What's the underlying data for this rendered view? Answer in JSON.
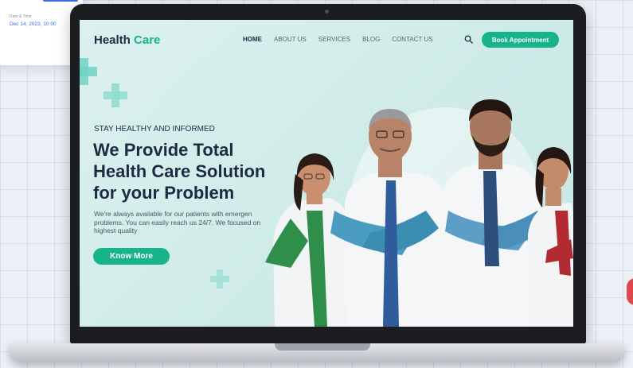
{
  "float_card": {
    "label": "Date & Time",
    "value": "Dec 14, 2023, 10:00"
  },
  "site": {
    "logo_main": "Health",
    "logo_accent": "Care",
    "nav": [
      {
        "label": "HOME",
        "active": true
      },
      {
        "label": "ABOUT US"
      },
      {
        "label": "SERVICES"
      },
      {
        "label": "BLOG"
      },
      {
        "label": "CONTACT US"
      }
    ],
    "search_icon": "search-icon",
    "book_button": "Book Appointment"
  },
  "hero": {
    "tagline": "STAY HEALTHY AND INFORMED",
    "headline_lines": [
      "We Provide Total",
      "Health Care Solution",
      "for your Problem"
    ],
    "description": "We're always available for our patients with emergen problems. You can easily reach us 24/7. We focused on highest quality",
    "cta": "Know More"
  },
  "colors": {
    "accent": "#17b38a",
    "heading": "#1c2a44",
    "screen_bg": "#d4eeeb"
  }
}
